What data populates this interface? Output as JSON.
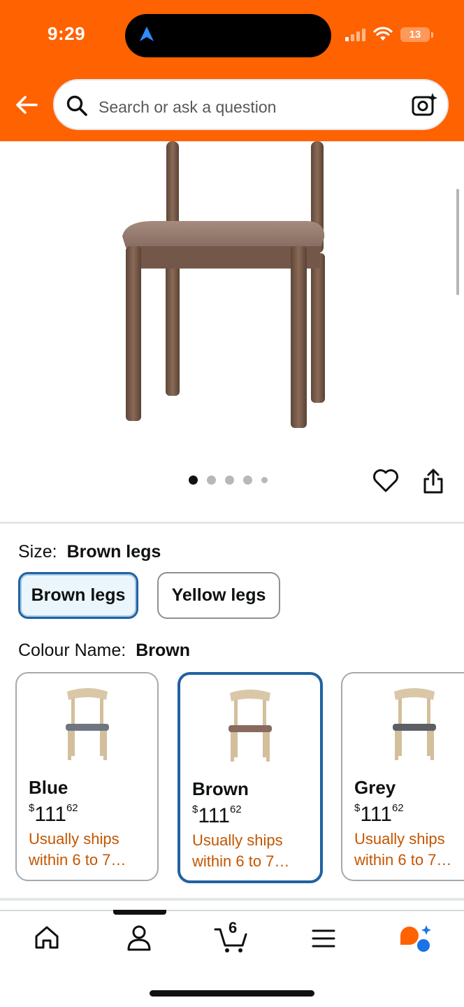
{
  "status_bar": {
    "time": "9:29",
    "battery": "13"
  },
  "header": {
    "search_placeholder": "Search or ask a question",
    "accent_color": "#ff6200"
  },
  "gallery": {
    "image_count": 5,
    "active_index": 0
  },
  "size": {
    "label": "Size:",
    "selected": "Brown legs",
    "options": [
      "Brown legs",
      "Yellow legs"
    ]
  },
  "colour": {
    "label": "Colour Name:",
    "selected": "Brown",
    "options": [
      {
        "name": "Blue",
        "currency": "$",
        "price_whole": "111",
        "price_fraction": "62",
        "shipping": "Usually ships within 6 to 7…",
        "seat_color": "#6f7681"
      },
      {
        "name": "Brown",
        "currency": "$",
        "price_whole": "111",
        "price_fraction": "62",
        "shipping": "Usually ships within 6 to 7…",
        "seat_color": "#8a6a5e"
      },
      {
        "name": "Grey",
        "currency": "$",
        "price_whole": "111",
        "price_fraction": "62",
        "shipping": "Usually ships within 6 to 7…",
        "seat_color": "#5c5f63"
      }
    ]
  },
  "bottom_nav": {
    "items": [
      "home-icon",
      "account-icon",
      "cart-icon",
      "menu-icon",
      "rufus-assistant-icon"
    ],
    "cart_count": "6"
  }
}
